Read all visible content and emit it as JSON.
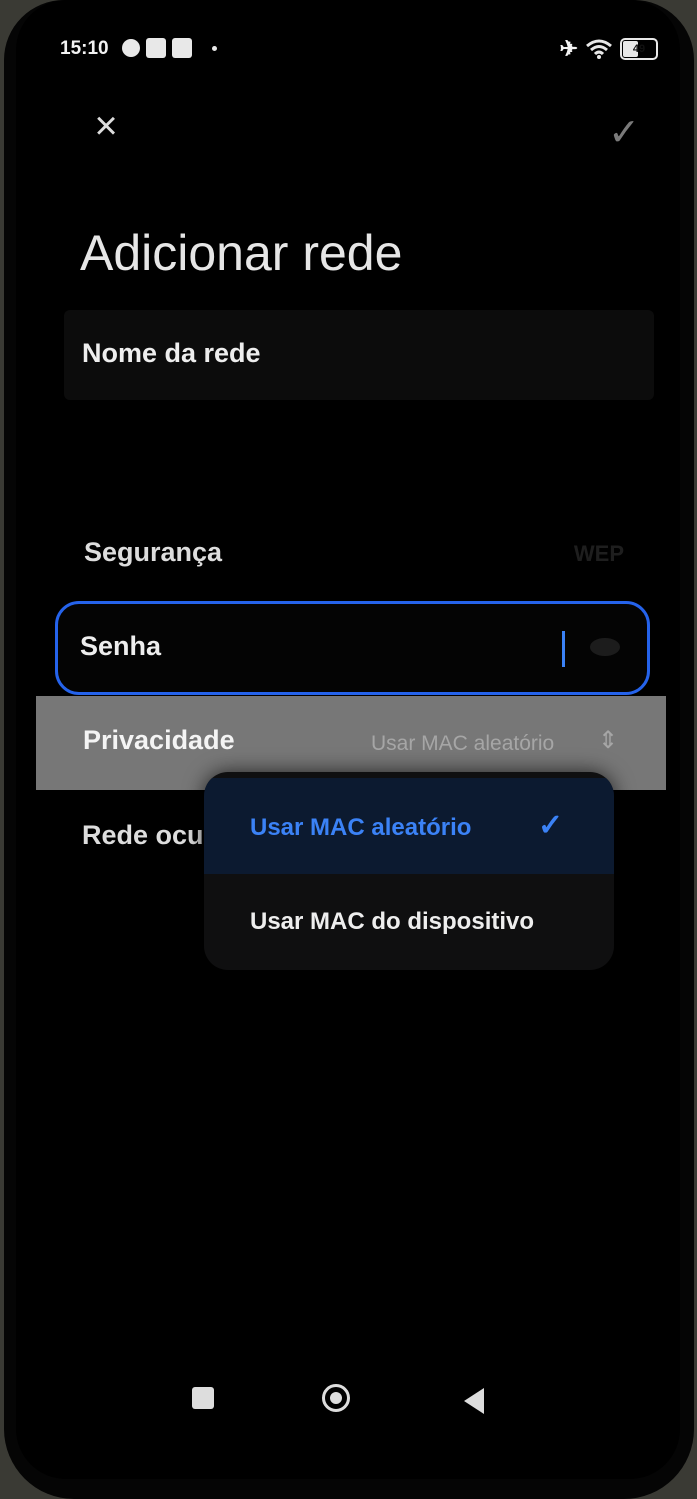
{
  "status_bar": {
    "time": "15:10",
    "battery": "49",
    "icons": [
      "settings-icon",
      "x-box-icon",
      "upload-box-icon",
      "airplane-icon",
      "wifi-icon",
      "battery-icon"
    ]
  },
  "header": {
    "title": "Adicionar rede",
    "close_icon": "×",
    "confirm_icon": "✓"
  },
  "form": {
    "network_name_label": "Nome da rede",
    "security_label": "Segurança",
    "security_value": "WEP",
    "password_label": "Senha",
    "privacy_label": "Privacidade",
    "privacy_value": "Usar MAC aleatório",
    "hidden_network_label": "Rede ocu"
  },
  "dropdown": {
    "options": [
      {
        "label": "Usar MAC aleatório",
        "selected": true
      },
      {
        "label": "Usar MAC do dispositivo",
        "selected": false
      }
    ]
  },
  "colors": {
    "accent": "#2563eb",
    "background": "#000000"
  }
}
